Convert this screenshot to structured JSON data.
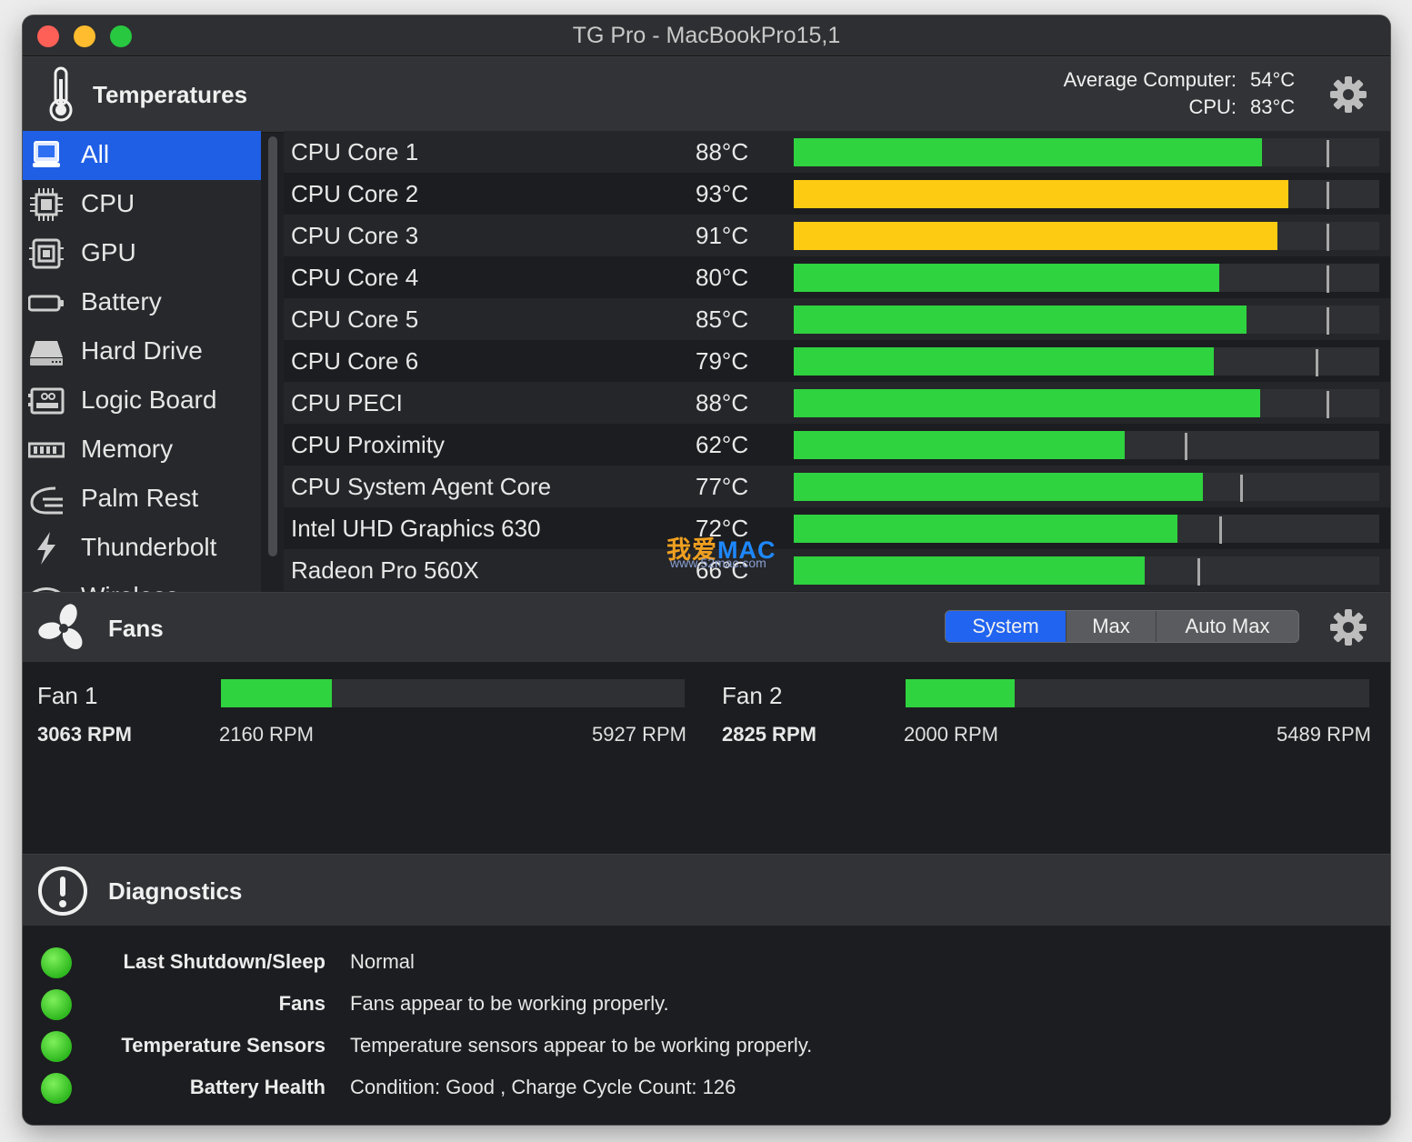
{
  "window": {
    "title": "TG Pro - MacBookPro15,1"
  },
  "temperatures": {
    "title": "Temperatures",
    "average_label": "Average Computer:",
    "average_value": "54°C",
    "cpu_label": "CPU:",
    "cpu_value": "83°C"
  },
  "sidebar": {
    "items": [
      {
        "label": "All",
        "icon": "macbook-icon"
      },
      {
        "label": "CPU",
        "icon": "chip-icon"
      },
      {
        "label": "GPU",
        "icon": "gpu-icon"
      },
      {
        "label": "Battery",
        "icon": "battery-icon"
      },
      {
        "label": "Hard Drive",
        "icon": "hard-drive-icon"
      },
      {
        "label": "Logic Board",
        "icon": "logic-board-icon"
      },
      {
        "label": "Memory",
        "icon": "memory-icon"
      },
      {
        "label": "Palm Rest",
        "icon": "palm-rest-icon"
      },
      {
        "label": "Thunderbolt",
        "icon": "thunderbolt-icon"
      },
      {
        "label": "Wireless",
        "icon": "wireless-icon"
      }
    ]
  },
  "sensors": [
    {
      "name": "CPU Core 1",
      "value": "88°C",
      "level": 0.8,
      "max_marker": 0.91,
      "color": "#2fd23f"
    },
    {
      "name": "CPU Core 2",
      "value": "93°C",
      "level": 0.845,
      "max_marker": 0.91,
      "color": "#fccb12"
    },
    {
      "name": "CPU Core 3",
      "value": "91°C",
      "level": 0.826,
      "max_marker": 0.91,
      "color": "#fccb12"
    },
    {
      "name": "CPU Core 4",
      "value": "80°C",
      "level": 0.726,
      "max_marker": 0.91,
      "color": "#2fd23f"
    },
    {
      "name": "CPU Core 5",
      "value": "85°C",
      "level": 0.773,
      "max_marker": 0.91,
      "color": "#2fd23f"
    },
    {
      "name": "CPU Core 6",
      "value": "79°C",
      "level": 0.717,
      "max_marker": 0.892,
      "color": "#2fd23f"
    },
    {
      "name": "CPU PECI",
      "value": "88°C",
      "level": 0.797,
      "max_marker": 0.91,
      "color": "#2fd23f"
    },
    {
      "name": "CPU Proximity",
      "value": "62°C",
      "level": 0.565,
      "max_marker": 0.667,
      "color": "#2fd23f"
    },
    {
      "name": "CPU System Agent Core",
      "value": "77°C",
      "level": 0.699,
      "max_marker": 0.763,
      "color": "#2fd23f"
    },
    {
      "name": "Intel UHD Graphics 630",
      "value": "72°C",
      "level": 0.655,
      "max_marker": 0.726,
      "color": "#2fd23f"
    },
    {
      "name": "Radeon Pro 560X",
      "value": "66°C",
      "level": 0.599,
      "max_marker": 0.69,
      "color": "#2fd23f"
    }
  ],
  "fans": {
    "title": "Fans",
    "modes": [
      "System",
      "Max",
      "Auto Max"
    ],
    "active_mode": "System",
    "items": [
      {
        "name": "Fan 1",
        "rpm": "3063 RPM",
        "min": "2160 RPM",
        "max": "5927 RPM",
        "level": 0.24
      },
      {
        "name": "Fan 2",
        "rpm": "2825 RPM",
        "min": "2000 RPM",
        "max": "5489 RPM",
        "level": 0.236
      }
    ]
  },
  "diagnostics": {
    "title": "Diagnostics",
    "rows": [
      {
        "label": "Last Shutdown/Sleep",
        "value": "Normal"
      },
      {
        "label": "Fans",
        "value": "Fans appear to be working properly."
      },
      {
        "label": "Temperature Sensors",
        "value": "Temperature sensors appear to be working properly."
      },
      {
        "label": "Battery Health",
        "value": "Condition: Good , Charge Cycle Count: 126"
      }
    ]
  },
  "watermark": {
    "brand_cn": "我爱",
    "brand_en": "MAC",
    "url": "www.52mac.com"
  },
  "colors": {
    "selected": "#1f5fe6",
    "ok": "#2fd23f",
    "warn": "#fccb12"
  }
}
